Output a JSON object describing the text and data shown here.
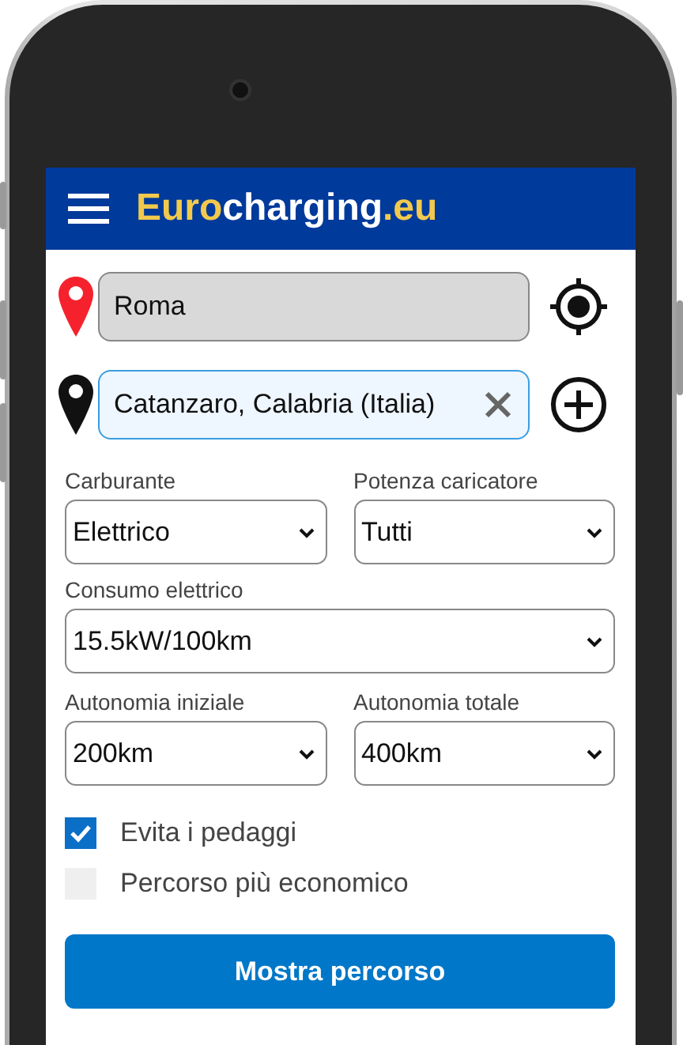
{
  "header": {
    "logo": [
      {
        "text": "Euro",
        "color": "#f2c94c"
      },
      {
        "text": "charging",
        "color": "#ffffff"
      },
      {
        "text": ".eu",
        "color": "#f2c94c"
      }
    ]
  },
  "route": [
    {
      "kind": "origin",
      "value": "Roma",
      "focused": false,
      "clearable": false
    },
    {
      "kind": "destination",
      "value": "Catanzaro, Calabria (Italia)",
      "focused": true,
      "clearable": true
    }
  ],
  "options": [
    [
      {
        "label": "Carburante",
        "value": "Elettrico"
      },
      {
        "label": "Potenza caricatore",
        "value": "Tutti"
      }
    ],
    [
      {
        "label": "Consumo elettrico",
        "value": "15.5kW/100km"
      }
    ],
    [
      {
        "label": "Autonomia iniziale",
        "value": "200km"
      },
      {
        "label": "Autonomia totale",
        "value": "400km"
      }
    ]
  ],
  "checkboxes": [
    {
      "label": "Evita i pedaggi",
      "checked": true
    },
    {
      "label": "Percorso più economico",
      "checked": false
    }
  ],
  "submit": "Mostra percorso"
}
